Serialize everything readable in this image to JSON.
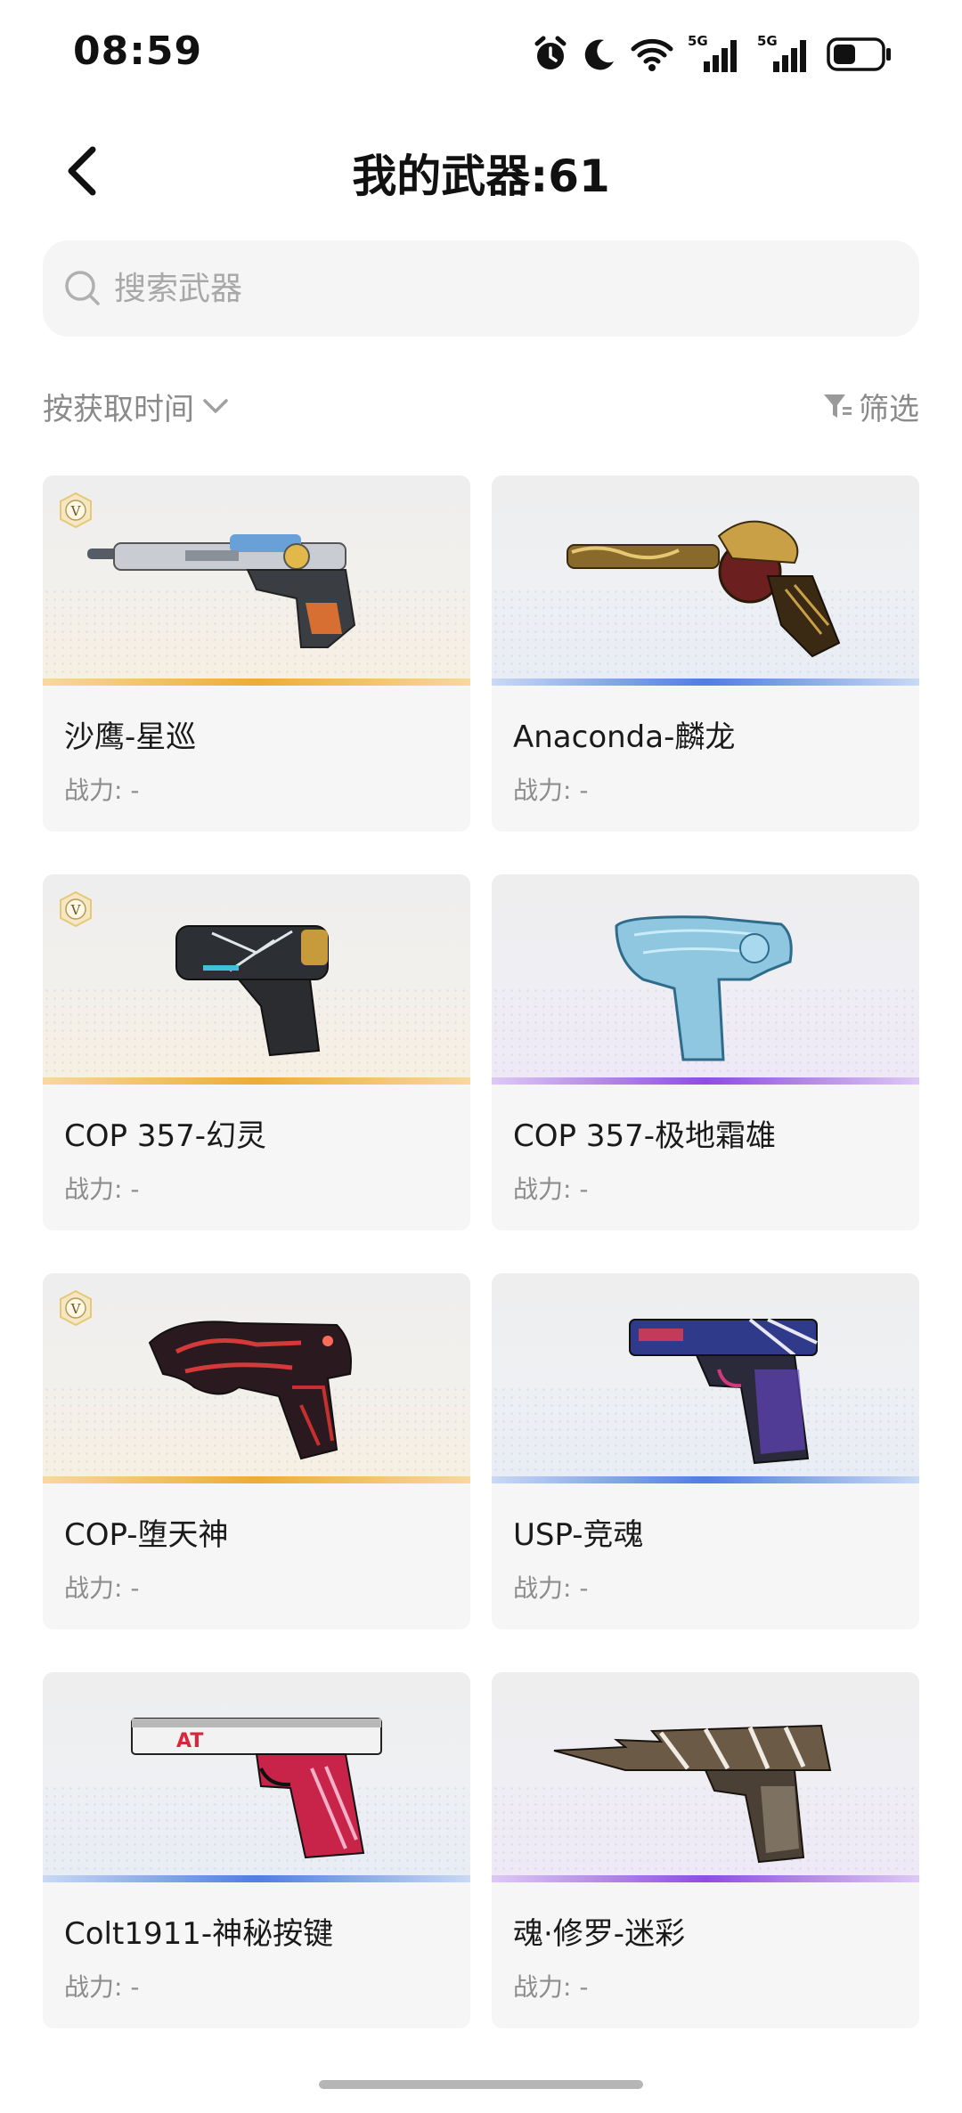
{
  "status_bar": {
    "time": "08:59",
    "icons": [
      "alarm-icon",
      "moon-icon",
      "wifi-icon",
      "signal-5g-icon",
      "signal-5g-icon",
      "battery-icon"
    ],
    "network_label": "5G"
  },
  "header": {
    "title": "我的武器:61",
    "back_icon": "chevron-left-icon"
  },
  "search": {
    "placeholder": "搜索武器",
    "value": ""
  },
  "toolbar": {
    "sort_label": "按获取时间",
    "filter_label": "筛选"
  },
  "colors": {
    "rarity_gold": "#f2a93b",
    "rarity_blue": "#4d7fe0",
    "rarity_purple": "#8e4de0",
    "muted_text": "#8a8a8a"
  },
  "weapons": [
    {
      "name": "沙鹰-星巡",
      "power": "战力: -",
      "rarity": "gold",
      "badge": "V"
    },
    {
      "name": "Anaconda-麟龙",
      "power": "战力: -",
      "rarity": "blue"
    },
    {
      "name": "COP 357-幻灵",
      "power": "战力: -",
      "rarity": "gold",
      "badge": "V"
    },
    {
      "name": "COP 357-极地霜雄",
      "power": "战力: -",
      "rarity": "purple"
    },
    {
      "name": "COP-堕天神",
      "power": "战力: -",
      "rarity": "gold",
      "badge": "V"
    },
    {
      "name": "USP-竞魂",
      "power": "战力: -",
      "rarity": "blue"
    },
    {
      "name": "Colt1911-神秘按键",
      "power": "战力: -",
      "rarity": "blue"
    },
    {
      "name": "魂·修罗-迷彩",
      "power": "战力: -",
      "rarity": "purple"
    }
  ]
}
